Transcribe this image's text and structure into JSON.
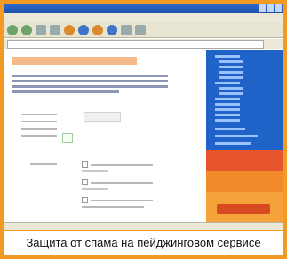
{
  "caption": "Защита от спама на пейджинговом сервисе"
}
